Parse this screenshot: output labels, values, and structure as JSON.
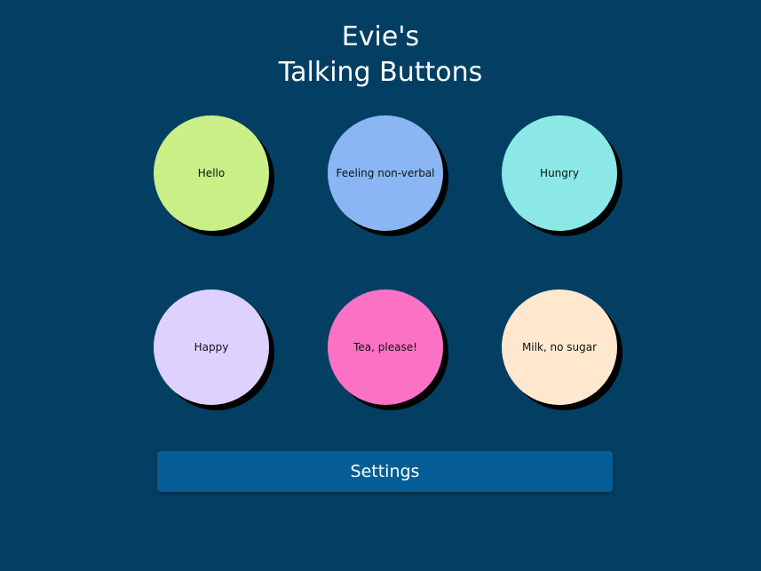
{
  "header": {
    "title_line1": "Evie's",
    "title_line2": "Talking Buttons"
  },
  "buttons": [
    {
      "label": "Hello",
      "color": "#c9ef86"
    },
    {
      "label": "Feeling non-verbal",
      "color": "#8ab7f3"
    },
    {
      "label": "Hungry",
      "color": "#8be8e7"
    },
    {
      "label": "Happy",
      "color": "#ddd2ff"
    },
    {
      "label": "Tea, please!",
      "color": "#fb72c5"
    },
    {
      "label": "Milk, no sugar",
      "color": "#ffe8ce"
    }
  ],
  "settings": {
    "label": "Settings"
  },
  "colors": {
    "background": "#033f63",
    "settings_button": "#075e96",
    "shadow": "#000000"
  }
}
